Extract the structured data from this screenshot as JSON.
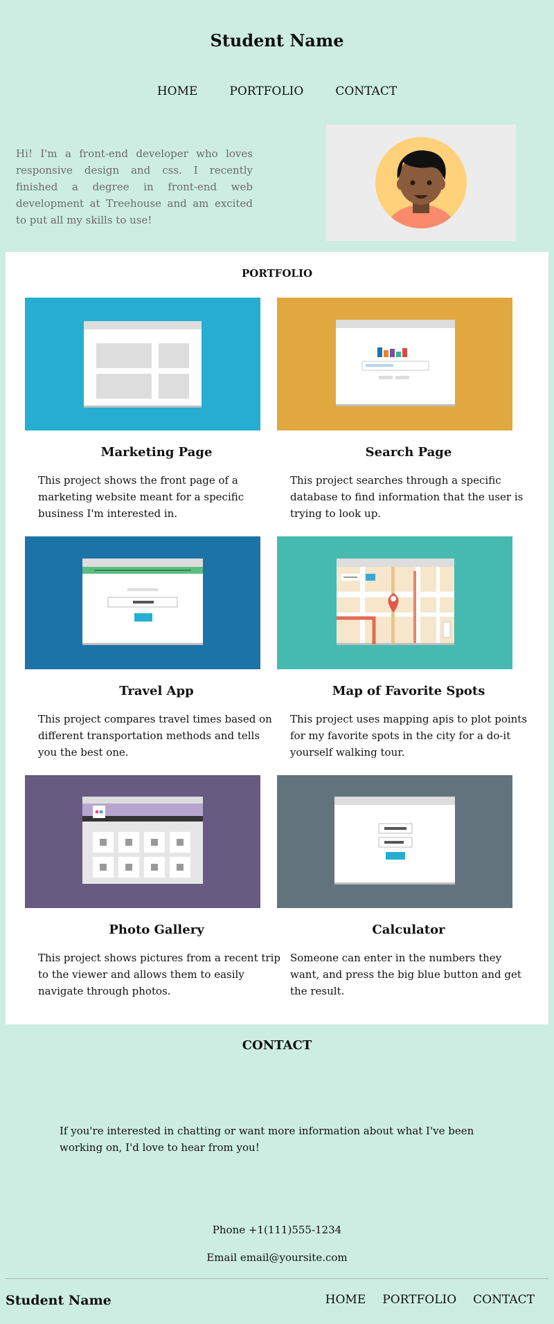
{
  "header": {
    "title": "Student Name",
    "nav": [
      "HOME",
      "PORTFOLIO",
      "CONTACT"
    ]
  },
  "intro": {
    "text": "Hi! I'm a front-end developer who loves responsive design and css. I recently finished a degree in front-end web development at Treehouse and am excited to put all my skills to use!"
  },
  "portfolio": {
    "heading": "PORTFOLIO",
    "projects": [
      {
        "title": "Marketing Page",
        "description": "This project shows the front page of a marketing website meant for a specific business I'm interested in.",
        "color": "#25aed1"
      },
      {
        "title": "Search Page",
        "description": "This project searches through a specific database to find information that the user is trying to look up.",
        "color": "#e1a840"
      },
      {
        "title": "Travel App",
        "description": "This project compares travel times based on different transportation methods and tells you the best one.",
        "color": "#1c73a8"
      },
      {
        "title": "Map of Favorite Spots",
        "description": "This project uses mapping apis to plot points for my favorite spots in the city for a do-it yourself walking tour.",
        "color": "#46bab0"
      },
      {
        "title": "Photo Gallery",
        "description": "This project shows pictures from a recent trip to the viewer and allows them to easily navigate through photos.",
        "color": "#675b82"
      },
      {
        "title": "Calculator",
        "description": "Someone can enter in the numbers they want, and press the big blue button and get the result.",
        "color": "#63737e"
      }
    ]
  },
  "contact": {
    "heading": "CONTACT",
    "text": "If you're interested in chatting or want more information about what I've been working on, I'd love to hear from you!",
    "phone": "Phone +1(111)555-1234",
    "email": "Email email@yoursite.com"
  },
  "footer": {
    "name": "Student Name",
    "nav": [
      "HOME",
      "PORTFOLIO",
      "CONTACT"
    ]
  },
  "colors": {
    "background": "#cdede2",
    "card_bg": "#ffffff",
    "avatar_bg": "#ececec",
    "avatar_circle": "#ffd17b",
    "avatar_shirt": "#f98a6b",
    "avatar_skin": "#8a5b3c"
  }
}
